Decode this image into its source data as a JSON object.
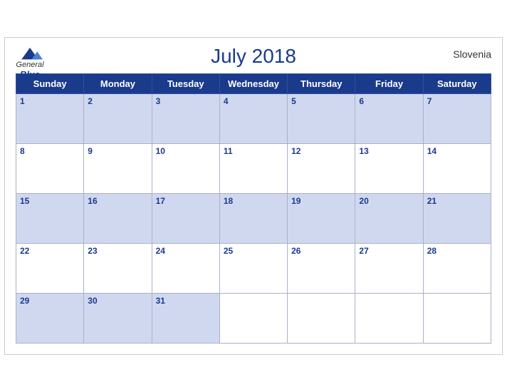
{
  "calendar": {
    "title": "July 2018",
    "country": "Slovenia",
    "days_of_week": [
      "Sunday",
      "Monday",
      "Tuesday",
      "Wednesday",
      "Thursday",
      "Friday",
      "Saturday"
    ],
    "weeks": [
      [
        {
          "day": "1",
          "empty": false
        },
        {
          "day": "2",
          "empty": false
        },
        {
          "day": "3",
          "empty": false
        },
        {
          "day": "4",
          "empty": false
        },
        {
          "day": "5",
          "empty": false
        },
        {
          "day": "6",
          "empty": false
        },
        {
          "day": "7",
          "empty": false
        }
      ],
      [
        {
          "day": "8",
          "empty": false
        },
        {
          "day": "9",
          "empty": false
        },
        {
          "day": "10",
          "empty": false
        },
        {
          "day": "11",
          "empty": false
        },
        {
          "day": "12",
          "empty": false
        },
        {
          "day": "13",
          "empty": false
        },
        {
          "day": "14",
          "empty": false
        }
      ],
      [
        {
          "day": "15",
          "empty": false
        },
        {
          "day": "16",
          "empty": false
        },
        {
          "day": "17",
          "empty": false
        },
        {
          "day": "18",
          "empty": false
        },
        {
          "day": "19",
          "empty": false
        },
        {
          "day": "20",
          "empty": false
        },
        {
          "day": "21",
          "empty": false
        }
      ],
      [
        {
          "day": "22",
          "empty": false
        },
        {
          "day": "23",
          "empty": false
        },
        {
          "day": "24",
          "empty": false
        },
        {
          "day": "25",
          "empty": false
        },
        {
          "day": "26",
          "empty": false
        },
        {
          "day": "27",
          "empty": false
        },
        {
          "day": "28",
          "empty": false
        }
      ],
      [
        {
          "day": "29",
          "empty": false
        },
        {
          "day": "30",
          "empty": false
        },
        {
          "day": "31",
          "empty": false
        },
        {
          "day": "",
          "empty": true
        },
        {
          "day": "",
          "empty": true
        },
        {
          "day": "",
          "empty": true
        },
        {
          "day": "",
          "empty": true
        }
      ]
    ],
    "logo": {
      "general": "General",
      "blue": "Blue"
    }
  }
}
